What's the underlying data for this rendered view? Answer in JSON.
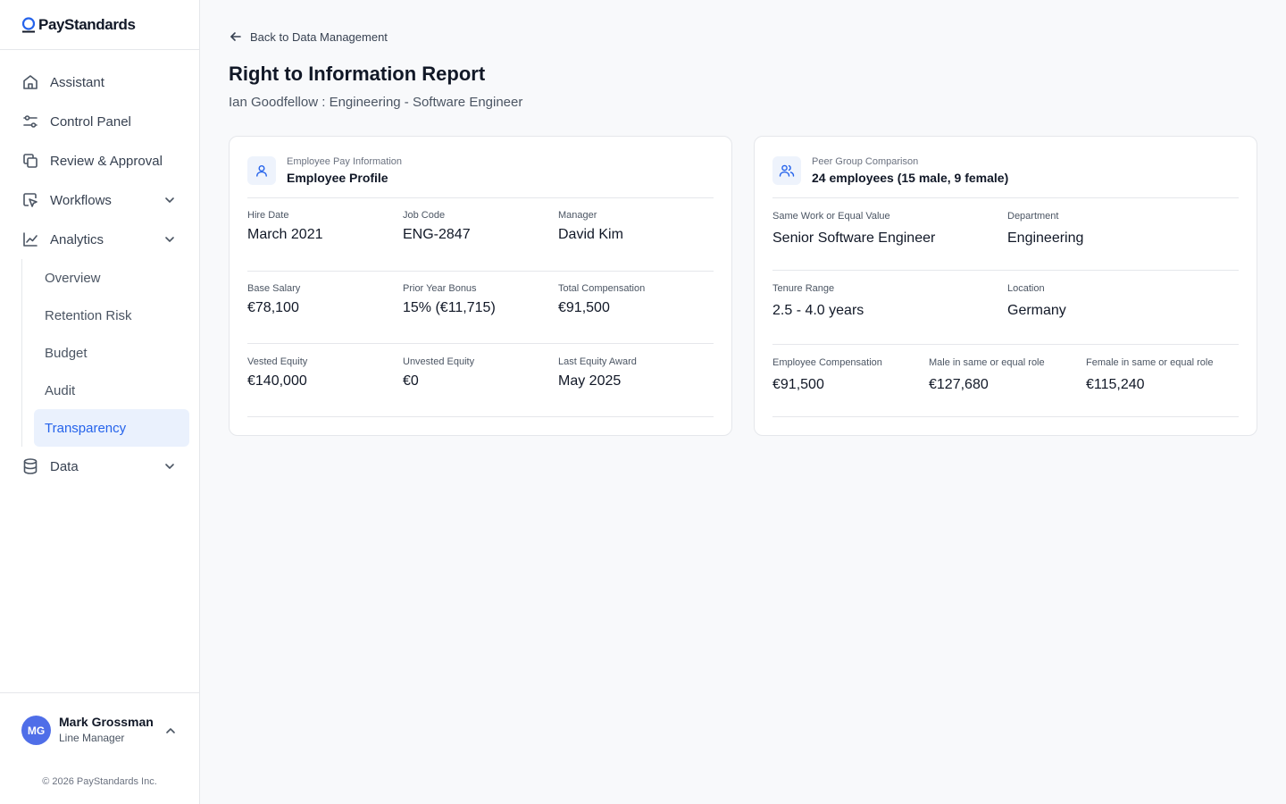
{
  "app": {
    "brand": "PayStandards"
  },
  "sidebar": {
    "items": [
      {
        "label": "Assistant",
        "icon": "home-icon"
      },
      {
        "label": "Control Panel",
        "icon": "sliders-icon"
      },
      {
        "label": "Review & Approval",
        "icon": "copy-icon"
      },
      {
        "label": "Workflows",
        "icon": "cursor-click-icon"
      },
      {
        "label": "Analytics",
        "icon": "chart-line-icon"
      },
      {
        "label": "Data",
        "icon": "database-icon"
      }
    ],
    "analytics_subitems": [
      {
        "label": "Overview"
      },
      {
        "label": "Retention Risk"
      },
      {
        "label": "Budget"
      },
      {
        "label": "Audit"
      },
      {
        "label": "Transparency",
        "active": true
      }
    ]
  },
  "user": {
    "initials": "MG",
    "name": "Mark Grossman",
    "role": "Line Manager"
  },
  "footer": {
    "copyright": "© 2026 PayStandards Inc."
  },
  "main": {
    "back_label": "Back to Data Management",
    "title": "Right to Information Report",
    "subtitle": "Ian Goodfellow : Engineering - Software Engineer"
  },
  "employee_card": {
    "eyebrow": "Employee Pay Information",
    "heading": "Employee Profile",
    "rows": [
      [
        {
          "label": "Hire Date",
          "value": "March 2021"
        },
        {
          "label": "Job Code",
          "value": "ENG-2847"
        },
        {
          "label": "Manager",
          "value": "David Kim"
        }
      ],
      [
        {
          "label": "Base Salary",
          "value": "€78,100"
        },
        {
          "label": "Prior Year Bonus",
          "value": "15% (€11,715)"
        },
        {
          "label": "Total Compensation",
          "value": "€91,500"
        }
      ],
      [
        {
          "label": "Vested Equity",
          "value": "€140,000"
        },
        {
          "label": "Unvested Equity",
          "value": "€0"
        },
        {
          "label": "Last Equity Award",
          "value": "May 2025"
        }
      ]
    ]
  },
  "peer_card": {
    "eyebrow": "Peer Group Comparison",
    "heading": "24 employees (15 male, 9 female)",
    "rows": [
      [
        {
          "label": "Same Work or Equal Value",
          "value": "Senior Software Engineer"
        },
        {
          "label": "Department",
          "value": "Engineering"
        }
      ],
      [
        {
          "label": "Tenure Range",
          "value": "2.5 - 4.0 years"
        },
        {
          "label": "Location",
          "value": "Germany"
        }
      ],
      [
        {
          "label": "Employee Compensation",
          "value": "€91,500"
        },
        {
          "label": "Male in same or equal role",
          "value": "€127,680"
        },
        {
          "label": "Female in same or equal role",
          "value": "€115,240"
        }
      ]
    ]
  },
  "colors": {
    "accent": "#2563eb",
    "active_bg": "#eaf1fd",
    "avatar": "#4f6ee8"
  }
}
